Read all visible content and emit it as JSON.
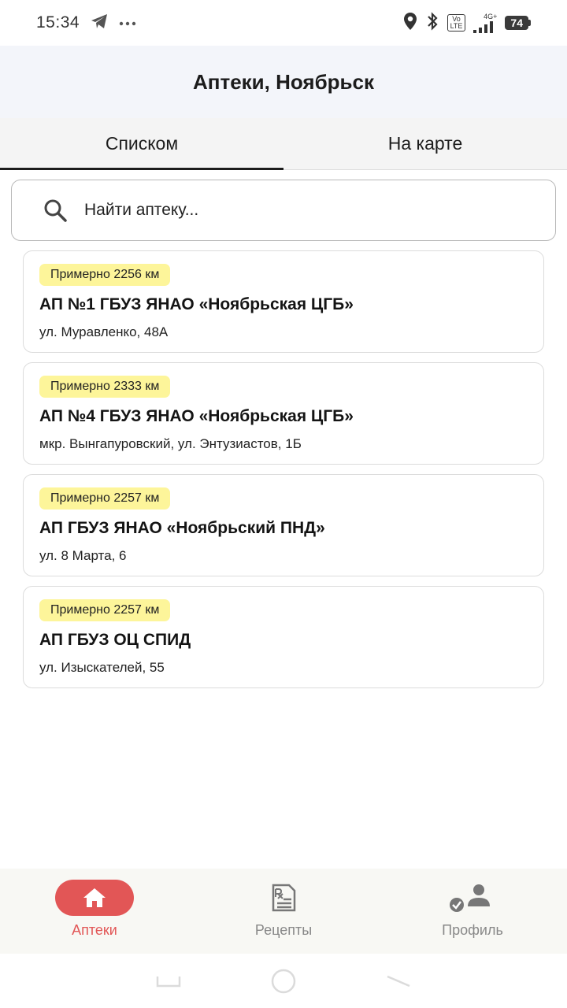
{
  "status_bar": {
    "time": "15:34",
    "net_tag_top": "Vo",
    "net_tag_bottom": "LTE",
    "signal_label": "4G+",
    "battery": "74"
  },
  "header": {
    "title": "Аптеки, Ноябрьск"
  },
  "tabs": [
    {
      "label": "Списком",
      "active": true
    },
    {
      "label": "На карте",
      "active": false
    }
  ],
  "search": {
    "placeholder": "Найти аптеку...",
    "value": ""
  },
  "pharmacies": [
    {
      "distance": "Примерно 2256 км",
      "name": "АП №1 ГБУЗ ЯНАО «Ноябрьская ЦГБ»",
      "address": "ул. Муравленко, 48А"
    },
    {
      "distance": "Примерно 2333 км",
      "name": "АП №4 ГБУЗ ЯНАО «Ноябрьская ЦГБ»",
      "address": "мкр. Вынгапуровский, ул. Энтузиастов, 1Б"
    },
    {
      "distance": "Примерно 2257 км",
      "name": "АП ГБУЗ ЯНАО «Ноябрьский ПНД»",
      "address": "ул. 8 Марта, 6"
    },
    {
      "distance": "Примерно 2257 км",
      "name": "АП ГБУЗ ОЦ СПИД",
      "address": "ул. Изыскателей, 55"
    }
  ],
  "bottom_nav": [
    {
      "label": "Аптеки",
      "icon": "home-icon",
      "active": true
    },
    {
      "label": "Рецепты",
      "icon": "prescription-icon",
      "active": false
    },
    {
      "label": "Профиль",
      "icon": "profile-icon",
      "active": false
    }
  ],
  "colors": {
    "accent": "#e25656",
    "badge_bg": "#fdf59a",
    "header_bg": "#f3f5fa"
  }
}
